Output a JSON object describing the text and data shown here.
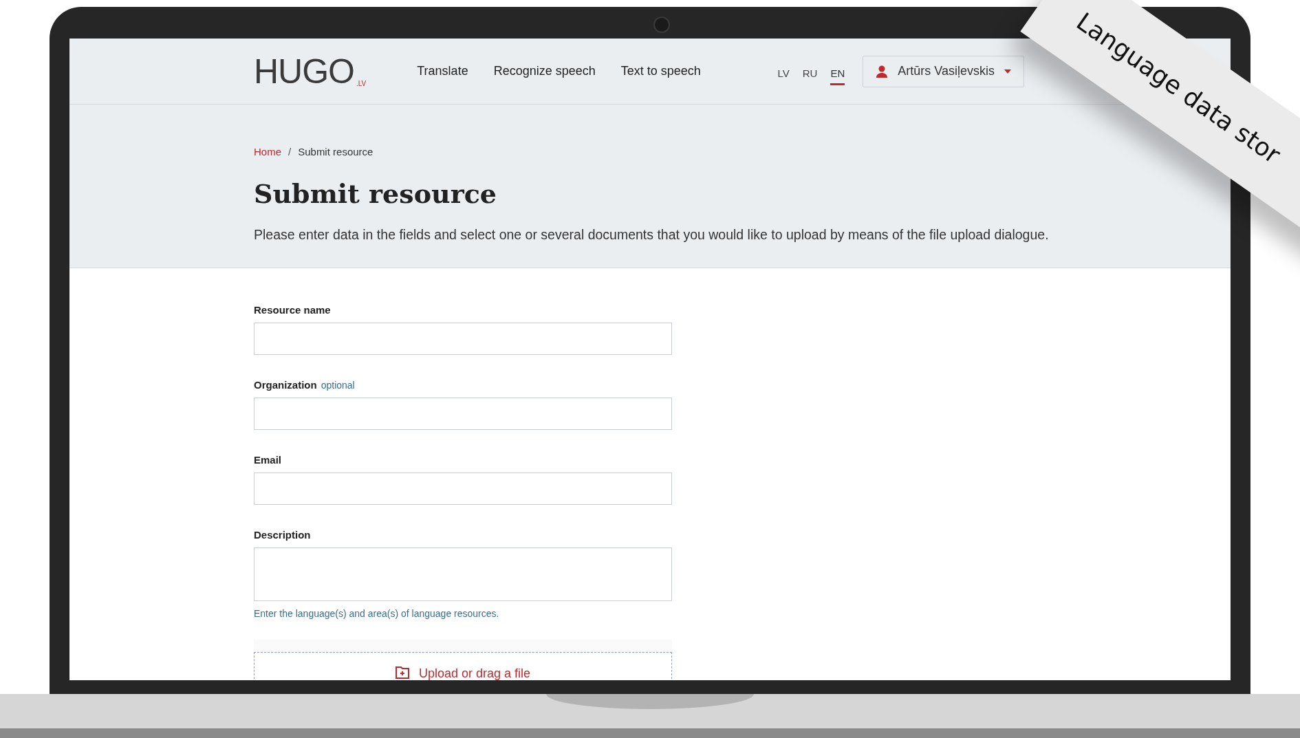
{
  "header": {
    "logo": {
      "main": "HUGO",
      "suffix": ".LV"
    },
    "nav": [
      {
        "label": "Translate"
      },
      {
        "label": "Recognize speech"
      },
      {
        "label": "Text to speech"
      }
    ],
    "languages": [
      {
        "label": "LV",
        "selected": false
      },
      {
        "label": "RU",
        "selected": false
      },
      {
        "label": "EN",
        "selected": true
      }
    ],
    "user": {
      "name": "Artūrs Vasiļevskis"
    }
  },
  "breadcrumb_separator": "/",
  "breadcrumb": [
    {
      "label": "Home",
      "kind": "link"
    },
    {
      "label": "Submit resource",
      "kind": "current"
    }
  ],
  "title": "Submit resource",
  "intro": "Please enter data in the fields and select one or several documents that you would like to upload by means of the file upload dialogue.",
  "form": {
    "fields": [
      {
        "label": "Resource name",
        "kind": "input"
      },
      {
        "label": "Organization",
        "optional": "optional",
        "kind": "input"
      },
      {
        "label": "Email",
        "kind": "input"
      },
      {
        "label": "Description",
        "kind": "textarea",
        "hint": "Enter the language(s) and area(s) of language resources."
      }
    ],
    "upload": "Upload or drag a file"
  },
  "banner": {
    "text": "Language data stor"
  }
}
